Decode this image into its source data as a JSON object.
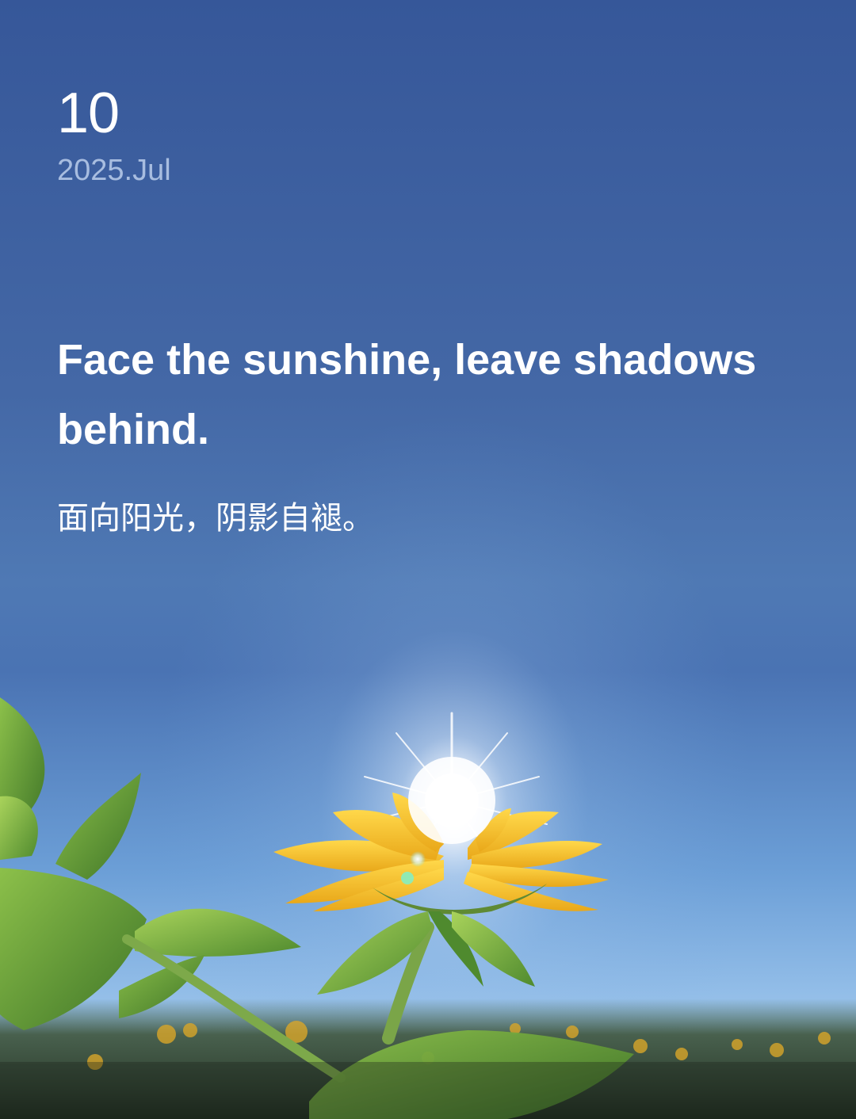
{
  "date": {
    "day": "10",
    "month_year": "2025.Jul"
  },
  "quote": {
    "english": "Face the sunshine, leave shadows behind.",
    "chinese": "面向阳光，阴影自褪。"
  },
  "photo": {
    "subject": "sunflower",
    "sky_top_color": "#365799",
    "sky_bottom_color": "#9fc4ea",
    "petal_color": "#f3c12a",
    "leaf_color": "#6fa53a"
  }
}
